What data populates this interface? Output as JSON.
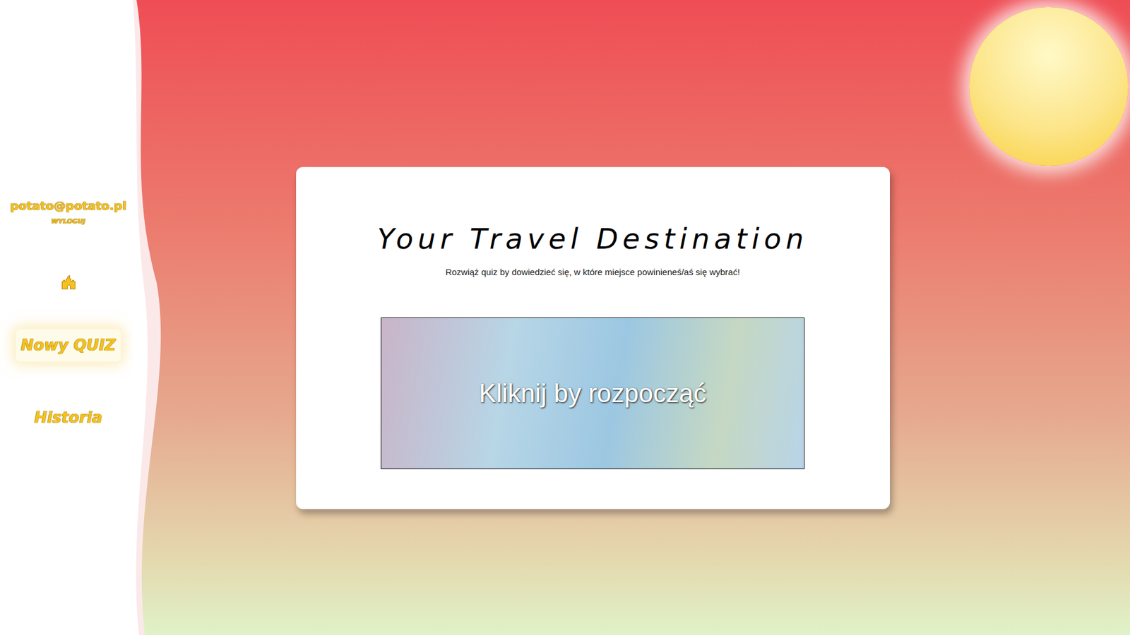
{
  "sidebar": {
    "user": {
      "email": "potato@potato.pl",
      "logout": "WYLOGUJ"
    },
    "items": [
      {
        "label": "Nowy QUIZ",
        "selected": true
      },
      {
        "label": "Historia",
        "selected": false
      }
    ]
  },
  "card": {
    "title": "Your Travel Destination",
    "subtitle": "Rozwiąż quiz by dowiedzieć się, w które miejsce powinieneś/aś się wybrać!",
    "start_button": "Kliknij by rozpocząć"
  }
}
